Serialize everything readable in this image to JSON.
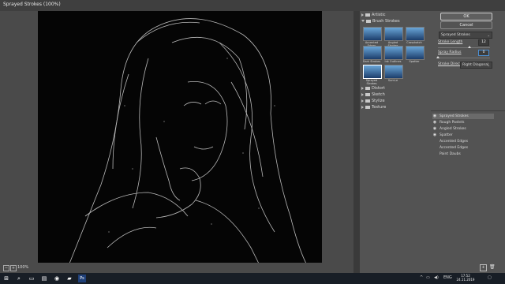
{
  "window": {
    "title": "Sprayed Strokes (100%)"
  },
  "preview": {
    "zoom": "100%",
    "zoom_out": "−",
    "zoom_in": "+"
  },
  "filters": {
    "categories": [
      {
        "label": "Artistic",
        "open": false
      },
      {
        "label": "Brush Strokes",
        "open": true
      },
      {
        "label": "Distort",
        "open": false
      },
      {
        "label": "Sketch",
        "open": false
      },
      {
        "label": "Stylize",
        "open": false
      },
      {
        "label": "Texture",
        "open": false
      }
    ],
    "brush_strokes": [
      "Accented Edges",
      "Angled Strokes",
      "Crosshatch",
      "Dark Strokes",
      "Ink Outlines",
      "Spatter",
      "Sprayed Strokes",
      "Sumi-e"
    ],
    "selected": "Sprayed Strokes"
  },
  "right": {
    "ok": "OK",
    "cancel": "Cancel",
    "filter_select": "Sprayed Strokes",
    "params": {
      "stroke_length": {
        "label": "Stroke Length",
        "value": "12",
        "fraction": 0.6
      },
      "spray_radius": {
        "label": "Spray Radius",
        "value": "0",
        "fraction": 0.0
      },
      "stroke_direction": {
        "label": "Stroke Direction:",
        "value": "Right Diagonal"
      }
    },
    "layers": [
      {
        "label": "Sprayed Strokes",
        "visible": true,
        "selected": true
      },
      {
        "label": "Rough Pastels",
        "visible": true,
        "selected": false
      },
      {
        "label": "Angled Strokes",
        "visible": true,
        "selected": false
      },
      {
        "label": "Spatter",
        "visible": true,
        "selected": false
      },
      {
        "label": "Accented Edges",
        "visible": false,
        "selected": false
      },
      {
        "label": "Accented Edges",
        "visible": false,
        "selected": false
      },
      {
        "label": "Paint Daubs",
        "visible": false,
        "selected": false
      }
    ]
  },
  "taskbar": {
    "start": "⊞",
    "search": "⌕",
    "apps": [
      "▭",
      "▤",
      "◉",
      "▰",
      "Ps"
    ],
    "tray": [
      "^",
      "▭",
      "◀)",
      "ENG"
    ],
    "time": "17:52",
    "date": "24.11.2019",
    "notif": "▢"
  }
}
